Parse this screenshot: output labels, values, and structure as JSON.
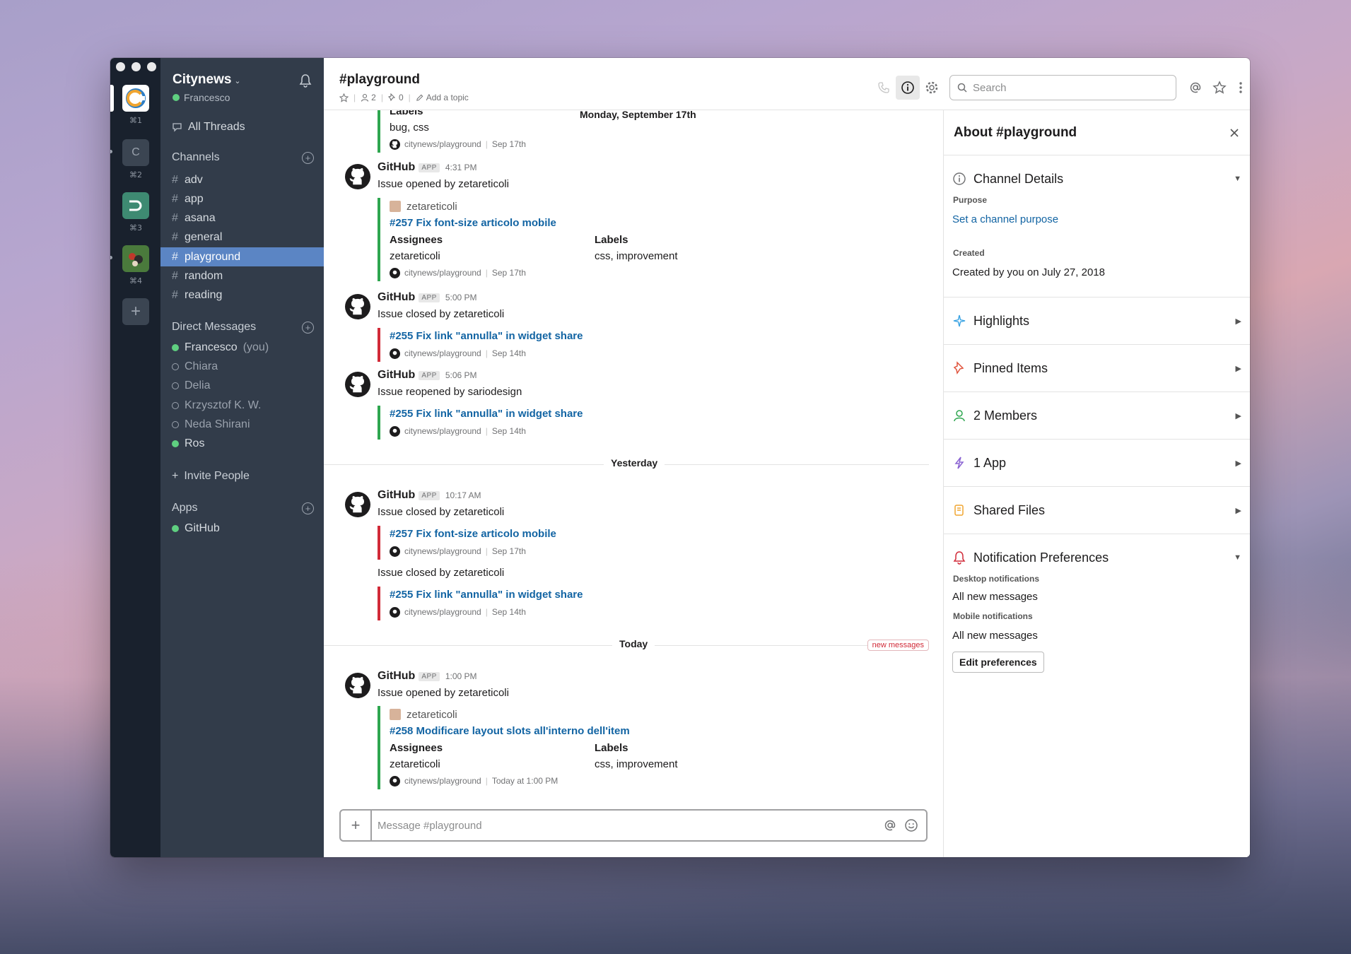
{
  "workspaces": [
    {
      "key": "⌘1",
      "letter": ""
    },
    {
      "key": "⌘2",
      "letter": "C"
    },
    {
      "key": "⌘3",
      "letter": ""
    },
    {
      "key": "⌘4",
      "letter": ""
    }
  ],
  "sidebar": {
    "team": "Citynews",
    "user": "Francesco",
    "all_threads": "All Threads",
    "channels_label": "Channels",
    "channels": [
      "adv",
      "app",
      "asana",
      "general",
      "playground",
      "random",
      "reading"
    ],
    "dm_label": "Direct Messages",
    "dms": [
      {
        "name": "Francesco",
        "suffix": "(you)"
      },
      {
        "name": "Chiara"
      },
      {
        "name": "Delia"
      },
      {
        "name": "Krzysztof K. W."
      },
      {
        "name": "Neda Shirani"
      },
      {
        "name": "Ros"
      }
    ],
    "invite": "Invite People",
    "apps_label": "Apps",
    "apps": [
      "GitHub"
    ]
  },
  "header": {
    "title": "#playground",
    "members": "2",
    "pins": "0",
    "add_topic": "Add a topic",
    "search_placeholder": "Search"
  },
  "messages": {
    "day1": "Monday, September 17th",
    "day2": "Yesterday",
    "day3": "Today",
    "new_messages": "new messages",
    "top_labels_label": "Labels",
    "top_labels_value": "bug, css",
    "top_footer_repo": "citynews/playground",
    "top_footer_date": "Sep 17th",
    "sender": "GitHub",
    "app_badge": "APP",
    "m1": {
      "time": "4:31 PM",
      "text": "Issue opened by zetareticoli",
      "author": "zetareticoli",
      "title": "#257 Fix font-size articolo mobile",
      "assignees_label": "Assignees",
      "assignees": "zetareticoli",
      "labels_label": "Labels",
      "labels": "css, improvement",
      "repo": "citynews/playground",
      "date": "Sep 17th"
    },
    "m2": {
      "time": "5:00 PM",
      "text": "Issue closed by zetareticoli",
      "title": "#255 Fix link \"annulla\" in widget share",
      "repo": "citynews/playground",
      "date": "Sep 14th"
    },
    "m3": {
      "time": "5:06 PM",
      "text": "Issue reopened by sariodesign",
      "title": "#255 Fix link \"annulla\" in widget share",
      "repo": "citynews/playground",
      "date": "Sep 14th"
    },
    "m4": {
      "time": "10:17 AM",
      "text": "Issue closed by zetareticoli",
      "title": "#257 Fix font-size articolo mobile",
      "repo": "citynews/playground",
      "date": "Sep 17th",
      "text2": "Issue closed by zetareticoli",
      "title2": "#255 Fix link \"annulla\" in widget share",
      "date2": "Sep 14th"
    },
    "m5": {
      "time": "1:00 PM",
      "text": "Issue opened by zetareticoli",
      "author": "zetareticoli",
      "title": "#258 Modificare layout slots all'interno dell'item",
      "assignees_label": "Assignees",
      "assignees": "zetareticoli",
      "labels_label": "Labels",
      "labels": "css, improvement",
      "repo": "citynews/playground",
      "date": "Today at 1:00 PM"
    },
    "composer_placeholder": "Message #playground"
  },
  "details": {
    "title": "About #playground",
    "channel_details": "Channel Details",
    "purpose_label": "Purpose",
    "purpose_link": "Set a channel purpose",
    "created_label": "Created",
    "created_value": "Created by you on July 27, 2018",
    "highlights": "Highlights",
    "pinned": "Pinned Items",
    "members": "2 Members",
    "apps": "1 App",
    "files": "Shared Files",
    "notif": "Notification Preferences",
    "desktop_label": "Desktop notifications",
    "desktop_value": "All new messages",
    "mobile_label": "Mobile notifications",
    "mobile_value": "All new messages",
    "edit_button": "Edit preferences"
  },
  "colors": {
    "sidebar": "#323c4a",
    "rail": "#19212d",
    "active_channel": "#5b85c4",
    "link": "#1264a3",
    "green_bar": "#2ea64f",
    "red_bar": "#d12a38"
  }
}
